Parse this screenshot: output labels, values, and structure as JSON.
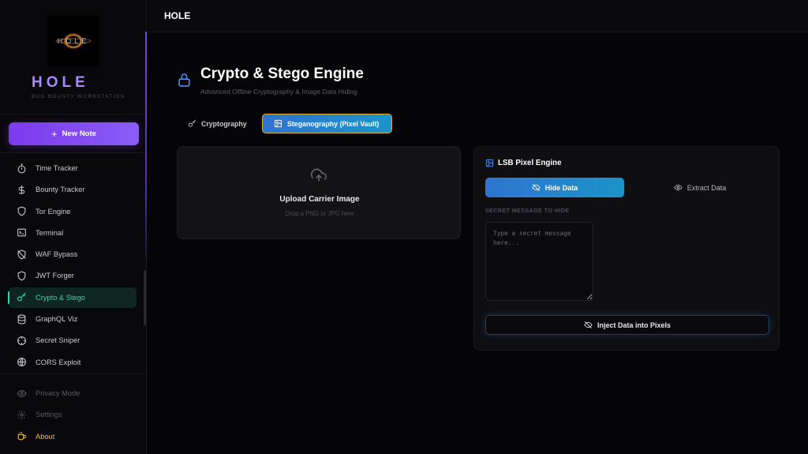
{
  "app": {
    "brand_title": "HOLE",
    "brand_subtitle": "BUG BOUNTY WORKSTATION",
    "logo_text": "HOLE",
    "topbar_title": "HOLE"
  },
  "sidebar": {
    "new_note_label": "New Note",
    "items": [
      {
        "label": "Time Tracker",
        "icon": "stopwatch-icon"
      },
      {
        "label": "Bounty Tracker",
        "icon": "dollar-icon"
      },
      {
        "label": "Tor Engine",
        "icon": "shield-icon"
      },
      {
        "label": "Terminal",
        "icon": "terminal-icon"
      },
      {
        "label": "WAF Bypass",
        "icon": "shield-off-icon"
      },
      {
        "label": "JWT Forger",
        "icon": "shield-icon"
      },
      {
        "label": "Crypto & Stego",
        "icon": "key-icon",
        "active": true
      },
      {
        "label": "GraphQL Viz",
        "icon": "database-icon"
      },
      {
        "label": "Secret Sniper",
        "icon": "crosshair-icon"
      },
      {
        "label": "CORS Exploit",
        "icon": "globe-icon"
      }
    ],
    "bottom_items": [
      {
        "label": "Privacy Mode",
        "icon": "eye-icon"
      },
      {
        "label": "Settings",
        "icon": "gear-icon"
      },
      {
        "label": "About",
        "icon": "coffee-icon"
      }
    ]
  },
  "main": {
    "title": "Crypto & Stego Engine",
    "subtitle": "Advanced Offline Cryptography & Image Data Hiding",
    "tabs": [
      {
        "label": "Cryptography",
        "active": false
      },
      {
        "label": "Steganography (Pixel Vault)",
        "active": true
      }
    ],
    "upload": {
      "title": "Upload Carrier Image",
      "hint": "Drop a PNG or JPG here"
    },
    "engine": {
      "title": "LSB Pixel Engine",
      "hide_label": "Hide Data",
      "extract_label": "Extract Data",
      "field_label": "SECRET MESSAGE TO HIDE",
      "placeholder": "Type a secret message here...",
      "inject_label": "Inject Data into Pixels"
    }
  },
  "colors": {
    "accent_purple": "#8b5cf6",
    "accent_green": "#34d3a8",
    "accent_blue": "#2f74d0",
    "accent_gold": "#fbbf24"
  }
}
